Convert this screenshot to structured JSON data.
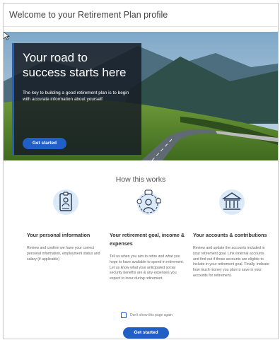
{
  "page": {
    "title": "Welcome to your Retirement Plan profile"
  },
  "hero": {
    "title": "Your road to success starts here",
    "body": "The key to building a good retirement plan is to begin with accurate information about yourself",
    "cta_label": "Get started"
  },
  "how": {
    "title": "How this works",
    "columns": [
      {
        "icon": "id-badge-icon",
        "title": "Your personal information",
        "body": "Review and confirm we have your correct personal information, employment status and salary (if applicable)"
      },
      {
        "icon": "person-goals-icon",
        "title": "Your retirement goal, income & expenses",
        "body": "Tell us when you aim to retire and what you hope to have available to spend in retirement. Let us know what your anticipated social security benefits are & any expenses you expect to incur during retirement."
      },
      {
        "icon": "bank-icon",
        "title": "Your accounts & contributions",
        "body": "Review and update the accounts included in your retirement goal. Link external accounts and find out if those accounts are eligible to include in your retirement goal. Finally, indicate how much money you plan to save in your accounts for retirement."
      }
    ]
  },
  "footer": {
    "checkbox_label": "Don't show this page again",
    "checkbox_checked": false,
    "cta_label": "Get started"
  },
  "colors": {
    "accent": "#1f5fc6",
    "icon_bg": "#dceaf8",
    "icon_stroke": "#2a3b57"
  }
}
